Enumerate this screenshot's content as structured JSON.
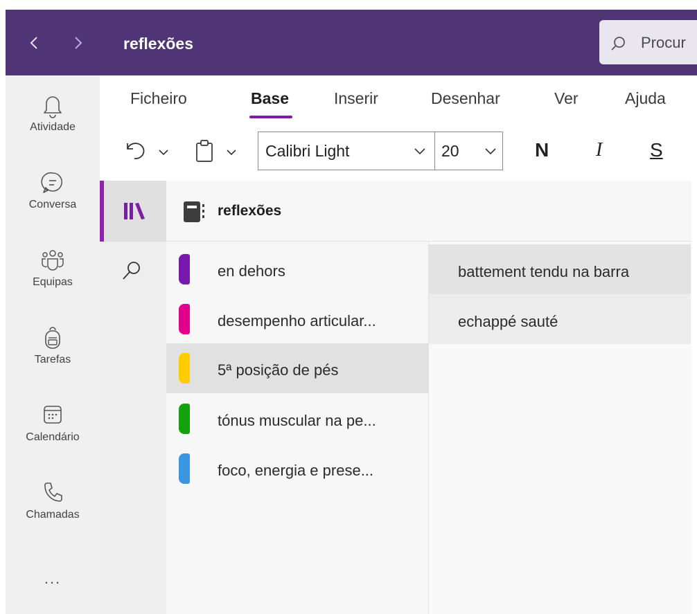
{
  "window": {
    "title": "reflexões"
  },
  "search": {
    "placeholder": "Procur"
  },
  "rail": {
    "items": [
      {
        "label": "Atividade",
        "icon": "bell-icon"
      },
      {
        "label": "Conversa",
        "icon": "chat-icon"
      },
      {
        "label": "Equipas",
        "icon": "teams-icon"
      },
      {
        "label": "Tarefas",
        "icon": "backpack-icon"
      },
      {
        "label": "Calendário",
        "icon": "calendar-icon"
      },
      {
        "label": "Chamadas",
        "icon": "phone-icon"
      }
    ],
    "more": "..."
  },
  "ribbon": {
    "tabs": [
      "Ficheiro",
      "Base",
      "Inserir",
      "Desenhar",
      "Ver",
      "Ajuda"
    ],
    "active_tab": "Base",
    "font_name": "Calibri Light",
    "font_size": "20",
    "bold": "N",
    "italic": "I",
    "strike": "S"
  },
  "notebook": {
    "title": "reflexões"
  },
  "sections": [
    {
      "label": "en dehors",
      "color": "#7719aa"
    },
    {
      "label": "desempenho articular...",
      "color": "#e3008c"
    },
    {
      "label": "5ª posição de pés",
      "color": "#ffcc00"
    },
    {
      "label": "tónus muscular na pe...",
      "color": "#13a10e"
    },
    {
      "label": "foco, energia e prese...",
      "color": "#3a96dd"
    }
  ],
  "pages": [
    {
      "label": "battement tendu na barra"
    },
    {
      "label": "echappé sauté"
    }
  ],
  "colors": {
    "titlebar": "#4f3576",
    "accent": "#7b1fa2"
  }
}
